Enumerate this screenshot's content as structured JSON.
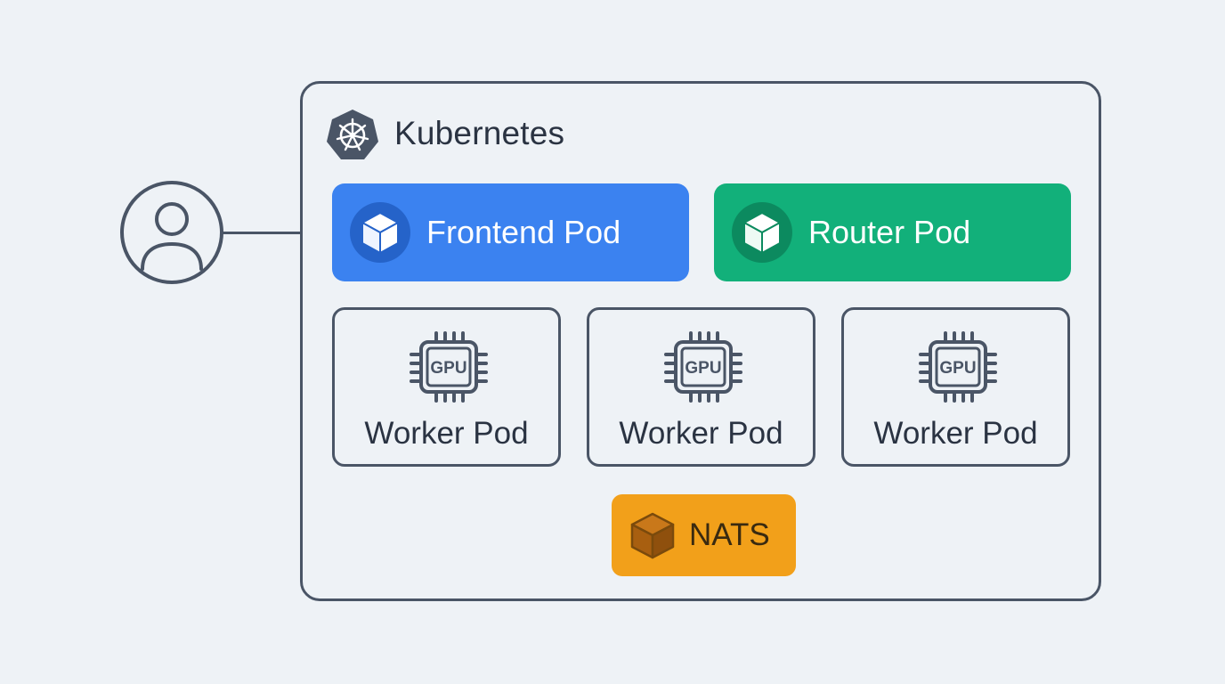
{
  "cluster": {
    "title": "Kubernetes",
    "icon": "kubernetes-wheel-icon"
  },
  "user": {
    "icon": "user-icon"
  },
  "pods": {
    "frontend": {
      "label": "Frontend Pod",
      "icon": "cube-icon",
      "color": "#3b82f0"
    },
    "router": {
      "label": "Router Pod",
      "icon": "cube-icon",
      "color": "#12b07a"
    }
  },
  "workers": [
    {
      "label": "Worker Pod",
      "chip_text": "GPU"
    },
    {
      "label": "Worker Pod",
      "chip_text": "GPU"
    },
    {
      "label": "Worker Pod",
      "chip_text": "GPU"
    }
  ],
  "nats": {
    "label": "NATS",
    "icon": "cube-icon",
    "color": "#f2a01a"
  },
  "colors": {
    "stroke": "#4a5566",
    "background": "#eef2f6",
    "text": "#2a3342"
  }
}
